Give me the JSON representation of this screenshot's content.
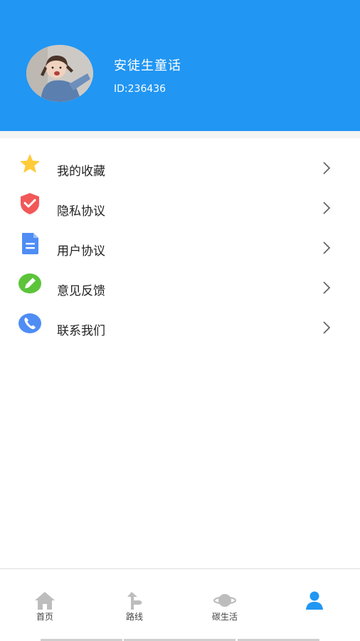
{
  "profile": {
    "name": "安徒生童话",
    "id_text": "ID:236436"
  },
  "menu": {
    "items": [
      {
        "label": "我的收藏",
        "icon": "star-icon",
        "color": "#FFCB3A"
      },
      {
        "label": "隐私协议",
        "icon": "shield-check-icon",
        "color": "#F25858"
      },
      {
        "label": "用户协议",
        "icon": "document-icon",
        "color": "#4F8DF5"
      },
      {
        "label": "意见反馈",
        "icon": "pencil-icon",
        "color": "#5BC43A"
      },
      {
        "label": "联系我们",
        "icon": "phone-icon",
        "color": "#4F8DF5"
      }
    ]
  },
  "tabbar": {
    "tabs": [
      {
        "label": "首页",
        "icon": "home-icon"
      },
      {
        "label": "路线",
        "icon": "signpost-icon"
      },
      {
        "label": "碳生活",
        "icon": "planet-icon"
      },
      {
        "label": "",
        "icon": "user-icon"
      }
    ],
    "active_color": "#2196F3",
    "inactive_color": "#BDBDBD"
  },
  "colors": {
    "header": "#2196F3"
  }
}
